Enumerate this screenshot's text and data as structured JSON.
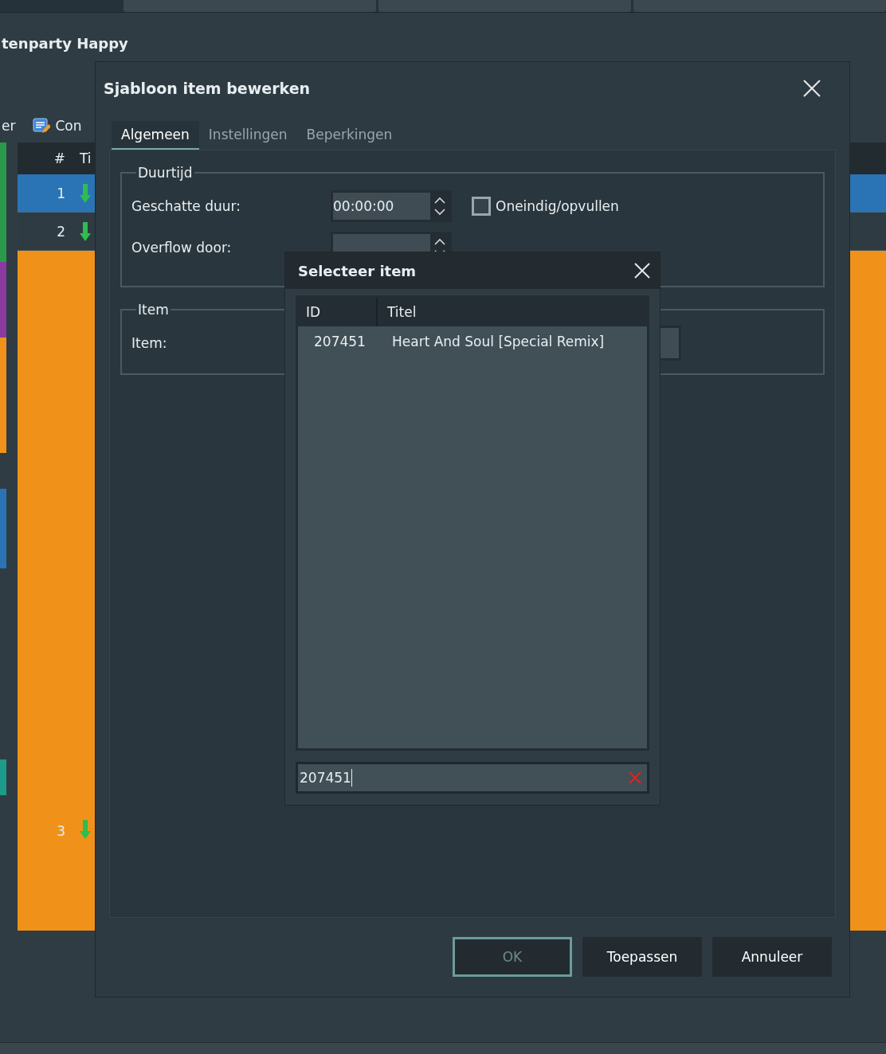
{
  "main_window": {
    "title": "tenparty Happy",
    "toolbar": [
      {
        "kind": "text",
        "label": "er"
      },
      {
        "kind": "icon",
        "label": "Con"
      }
    ],
    "table": {
      "columns": [
        "#",
        "Ti"
      ],
      "rows": [
        {
          "number": "1",
          "selected": true
        },
        {
          "number": "2",
          "selected": false
        },
        {
          "number": "3",
          "selected": false,
          "color": "#f0921a"
        }
      ]
    }
  },
  "dialog": {
    "title": "Sjabloon item bewerken",
    "tabs": [
      {
        "label": "Algemeen",
        "selected": true
      },
      {
        "label": "Instellingen",
        "selected": false
      },
      {
        "label": "Beperkingen",
        "selected": false
      }
    ],
    "duration_group": {
      "title": "Duurtijd",
      "fields": [
        {
          "label": "Geschatte duur:",
          "value": "00:00:00"
        },
        {
          "label": "Overflow door:"
        }
      ],
      "checkbox": {
        "label": "Oneindig/opvullen",
        "checked": false
      }
    },
    "item_group": {
      "title": "Item",
      "label": "Item:"
    },
    "buttons": [
      {
        "label": "OK",
        "default": true,
        "disabled": true
      },
      {
        "label": "Toepassen",
        "default": false,
        "disabled": false
      },
      {
        "label": "Annuleer",
        "default": false,
        "disabled": false
      }
    ]
  },
  "picker": {
    "title": "Selecteer item",
    "columns": [
      "ID",
      "Titel"
    ],
    "rows": [
      {
        "id": "207451",
        "title": "Heart And Soul [Special Remix]"
      }
    ],
    "search": {
      "value": "207451"
    }
  }
}
